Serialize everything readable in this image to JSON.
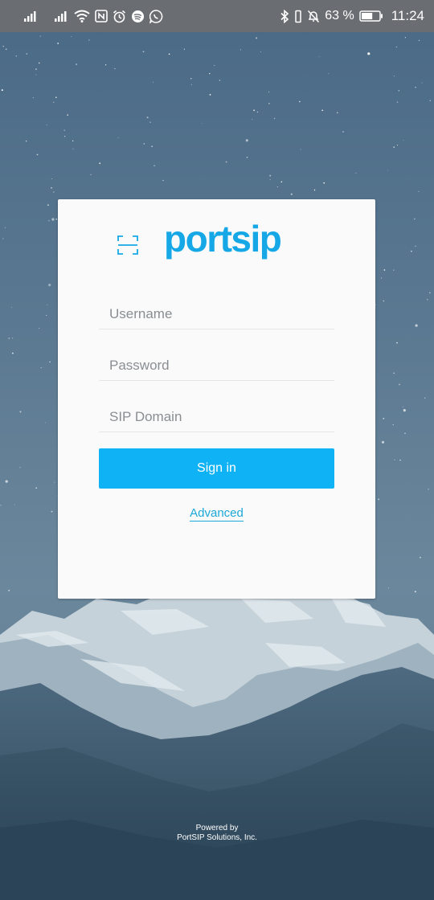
{
  "status_bar": {
    "battery_percent": "63 %",
    "battery_level": 0.63,
    "time": "11:24",
    "icons_left": [
      "signal-icon",
      "signal-icon",
      "wifi-icon",
      "nfc-icon",
      "alarm-icon",
      "spotify-icon",
      "whatsapp-icon"
    ],
    "icons_right": [
      "bluetooth-icon",
      "vibrate-icon",
      "mute-icon",
      "battery-icon"
    ]
  },
  "login": {
    "logo_text": "portsip",
    "username_placeholder": "Username",
    "password_placeholder": "Password",
    "domain_placeholder": "SIP Domain",
    "signin_label": "Sign in",
    "advanced_label": "Advanced"
  },
  "footer": {
    "line1": "Powered by",
    "line2": "PortSIP Solutions, Inc."
  },
  "colors": {
    "brand": "#16a8e6",
    "button": "#0fb3f5",
    "link": "#1ca8d8",
    "status_bar": "#6a6e73"
  }
}
